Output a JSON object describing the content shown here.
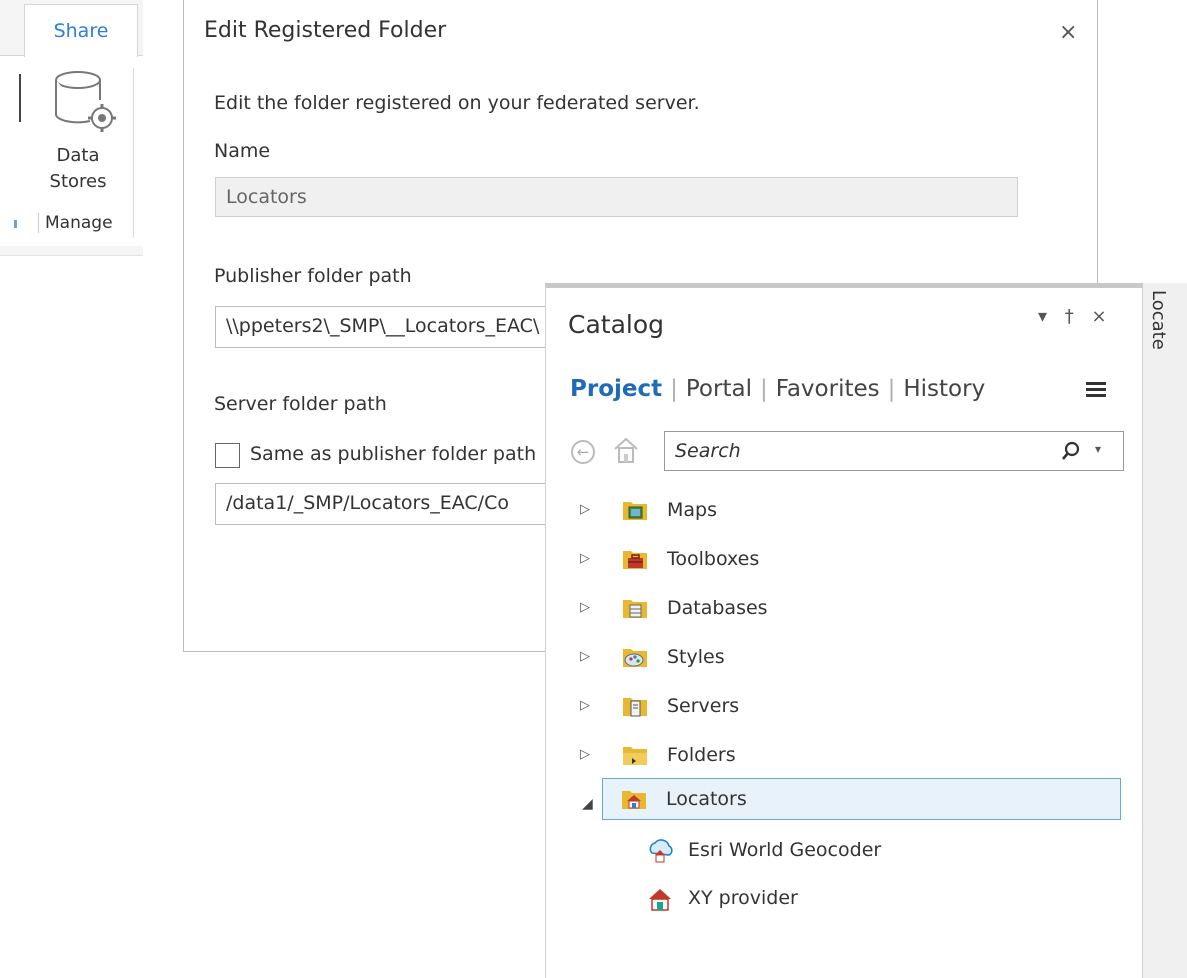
{
  "ribbon": {
    "tab_label": "Share",
    "data_stores_line1": "Data",
    "data_stores_line2": "Stores",
    "group_label": "Manage"
  },
  "dialog": {
    "title": "Edit Registered Folder",
    "close_glyph": "×",
    "description": "Edit the folder registered on your federated server.",
    "name_label": "Name",
    "name_value": "Locators",
    "publisher_label": "Publisher folder path",
    "publisher_value": "\\\\ppeters2\\_SMP\\__Locators_EAC\\",
    "server_label": "Server folder path",
    "same_as_label": "Same as publisher folder path",
    "server_value": "/data1/_SMP/Locators_EAC/Co"
  },
  "catalog": {
    "title": "Catalog",
    "pane_controls": "▾ † ×",
    "tabs": [
      "Project",
      "Portal",
      "Favorites",
      "History"
    ],
    "search_placeholder": "Search",
    "tree": [
      {
        "label": "Maps",
        "icon": "maps-folder-icon"
      },
      {
        "label": "Toolboxes",
        "icon": "toolboxes-folder-icon"
      },
      {
        "label": "Databases",
        "icon": "databases-folder-icon"
      },
      {
        "label": "Styles",
        "icon": "styles-folder-icon"
      },
      {
        "label": "Servers",
        "icon": "servers-folder-icon"
      },
      {
        "label": "Folders",
        "icon": "folders-folder-icon"
      },
      {
        "label": "Locators",
        "icon": "locators-folder-icon",
        "expanded": true,
        "selected": true
      }
    ],
    "locator_children": [
      {
        "label": "Esri World Geocoder",
        "icon": "world-geocoder-icon"
      },
      {
        "label": "XY provider",
        "icon": "xy-provider-icon"
      }
    ]
  },
  "locate_tab": "Locate",
  "colors": {
    "accent": "#1f6bb8",
    "selection": "#e7f2fb",
    "folder": "#e8b930"
  }
}
